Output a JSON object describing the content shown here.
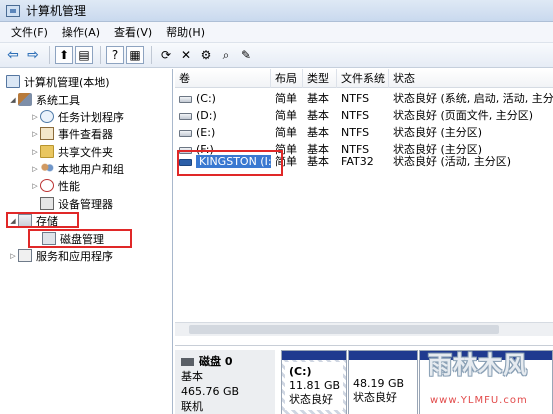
{
  "window": {
    "title": "计算机管理"
  },
  "menu": [
    "文件(F)",
    "操作(A)",
    "查看(V)",
    "帮助(H)"
  ],
  "toolbar": {
    "icons": [
      "back-arrow-icon",
      "forward-arrow-icon",
      "folder-up-icon",
      "show-tree-icon",
      "help-icon",
      "properties-icon",
      "refresh-icon",
      "delete-icon",
      "settings-icon",
      "search-icon",
      "wizard-icon"
    ],
    "symbols": {
      "back": "⇦",
      "forward": "⇨",
      "up": "⬆",
      "tree": "▤",
      "help": "?",
      "props": "▦",
      "refresh": "⟳",
      "delete": "✕",
      "settings": "⚙",
      "search": "⌕",
      "wizard": "✎"
    }
  },
  "tree": {
    "root": "计算机管理(本地)",
    "system_tools": "系统工具",
    "task_scheduler": "任务计划程序",
    "event_viewer": "事件查看器",
    "shared_folders": "共享文件夹",
    "local_users": "本地用户和组",
    "performance": "性能",
    "device_manager": "设备管理器",
    "storage": "存储",
    "disk_management": "磁盘管理",
    "services_apps": "服务和应用程序"
  },
  "volumes": {
    "columns": [
      "卷",
      "布局",
      "类型",
      "文件系统",
      "状态"
    ],
    "rows": [
      {
        "volume": "(C:)",
        "layout": "简单",
        "type": "基本",
        "fs": "NTFS",
        "status": "状态良好 (系统, 启动, 活动, 主分区)"
      },
      {
        "volume": "(D:)",
        "layout": "简单",
        "type": "基本",
        "fs": "NTFS",
        "status": "状态良好 (页面文件, 主分区)"
      },
      {
        "volume": "(E:)",
        "layout": "简单",
        "type": "基本",
        "fs": "NTFS",
        "status": "状态良好 (主分区)"
      },
      {
        "volume": "(F:)",
        "layout": "简单",
        "type": "基本",
        "fs": "NTFS",
        "status": "状态良好 (主分区)"
      },
      {
        "volume": "KINGSTON (I:)",
        "layout": "简单",
        "type": "基本",
        "fs": "FAT32",
        "status": "状态良好 (活动, 主分区)"
      }
    ]
  },
  "disk0": {
    "name": "磁盘 0",
    "type": "基本",
    "size": "465.76 GB",
    "state": "联机",
    "partitions": [
      {
        "label": "(C:)",
        "size": "11.81 GB N",
        "status": "状态良好"
      },
      {
        "label": "",
        "size": "48.19 GB",
        "status": "状态良好"
      }
    ]
  },
  "watermark": {
    "title": "雨林木风",
    "url": "www.YLMFU.com"
  }
}
